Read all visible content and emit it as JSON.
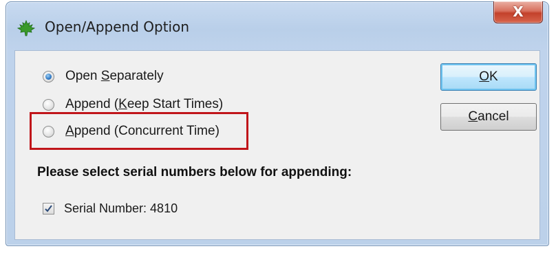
{
  "window": {
    "title": "Open/Append Option",
    "close_label": "X",
    "icon": "maple-leaf-icon"
  },
  "options": [
    {
      "label": "Open Separately",
      "mnemonic": "S",
      "prefix": "Open ",
      "rest": "eparately",
      "checked": true
    },
    {
      "label": "Append (Keep Start Times)",
      "mnemonic": "K",
      "prefix": "Append (",
      "rest": "eep Start Times)",
      "checked": false
    },
    {
      "label": "Append (Concurrent Time)",
      "mnemonic": "A",
      "prefix": "",
      "rest": "ppend (Concurrent Time)",
      "checked": false
    }
  ],
  "buttons": {
    "ok": {
      "label": "OK",
      "mnemonic": "O",
      "rest": "K"
    },
    "cancel": {
      "label": "Cancel",
      "mnemonic": "C",
      "rest": "ancel"
    }
  },
  "serials": {
    "heading": "Please select serial numbers below for appending:",
    "items": [
      {
        "label": "Serial Number: 4810",
        "checked": true
      }
    ]
  },
  "colors": {
    "highlight": "#c0151a",
    "icon": "#3a9a2a"
  }
}
